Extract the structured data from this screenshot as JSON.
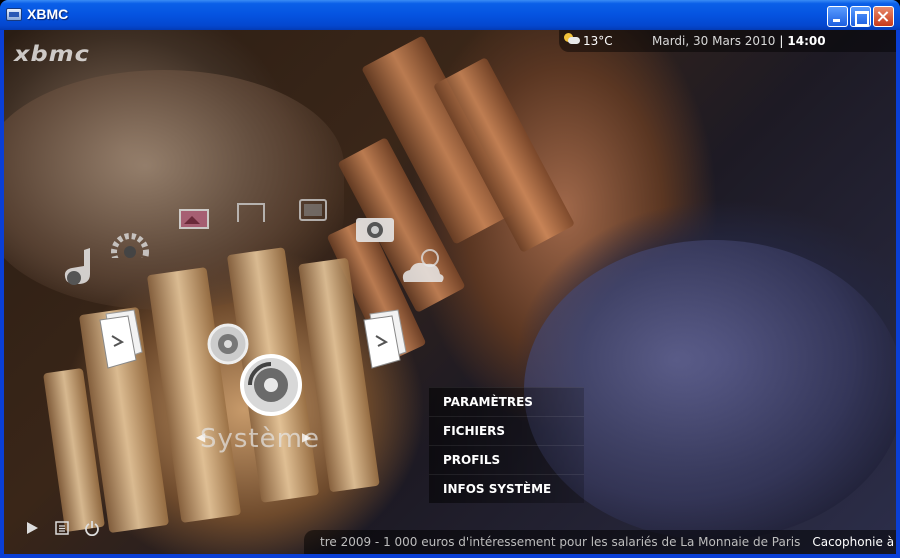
{
  "window": {
    "title": "XBMC"
  },
  "topbar": {
    "logo": "xbmc",
    "temperature": "13°C",
    "date": "Mardi, 30 Mars 2010",
    "separator": "|",
    "time": "14:00"
  },
  "home": {
    "selected_label": "Système",
    "arrow_left": "◀",
    "arrow_right": "▶"
  },
  "submenu": {
    "items": [
      {
        "label": "PARAMÈTRES"
      },
      {
        "label": "FICHIERS"
      },
      {
        "label": "PROFILS"
      },
      {
        "label": "INFOS SYSTÈME"
      }
    ]
  },
  "ticker": {
    "headline_a": "tre 2009 - 1 000 euros d'intéressement pour les salariés de La Monnaie de Paris",
    "headline_b": "Cacophonie à l'UM"
  },
  "icons": [
    "weather-icon",
    "play-icon",
    "list-icon",
    "power-icon",
    "music-icon",
    "settings-icon",
    "pictures-icon",
    "video-icon",
    "tv-icon",
    "camera-icon",
    "weather-cloud-icon",
    "files-icon",
    "system-icon",
    "programs-icon"
  ]
}
